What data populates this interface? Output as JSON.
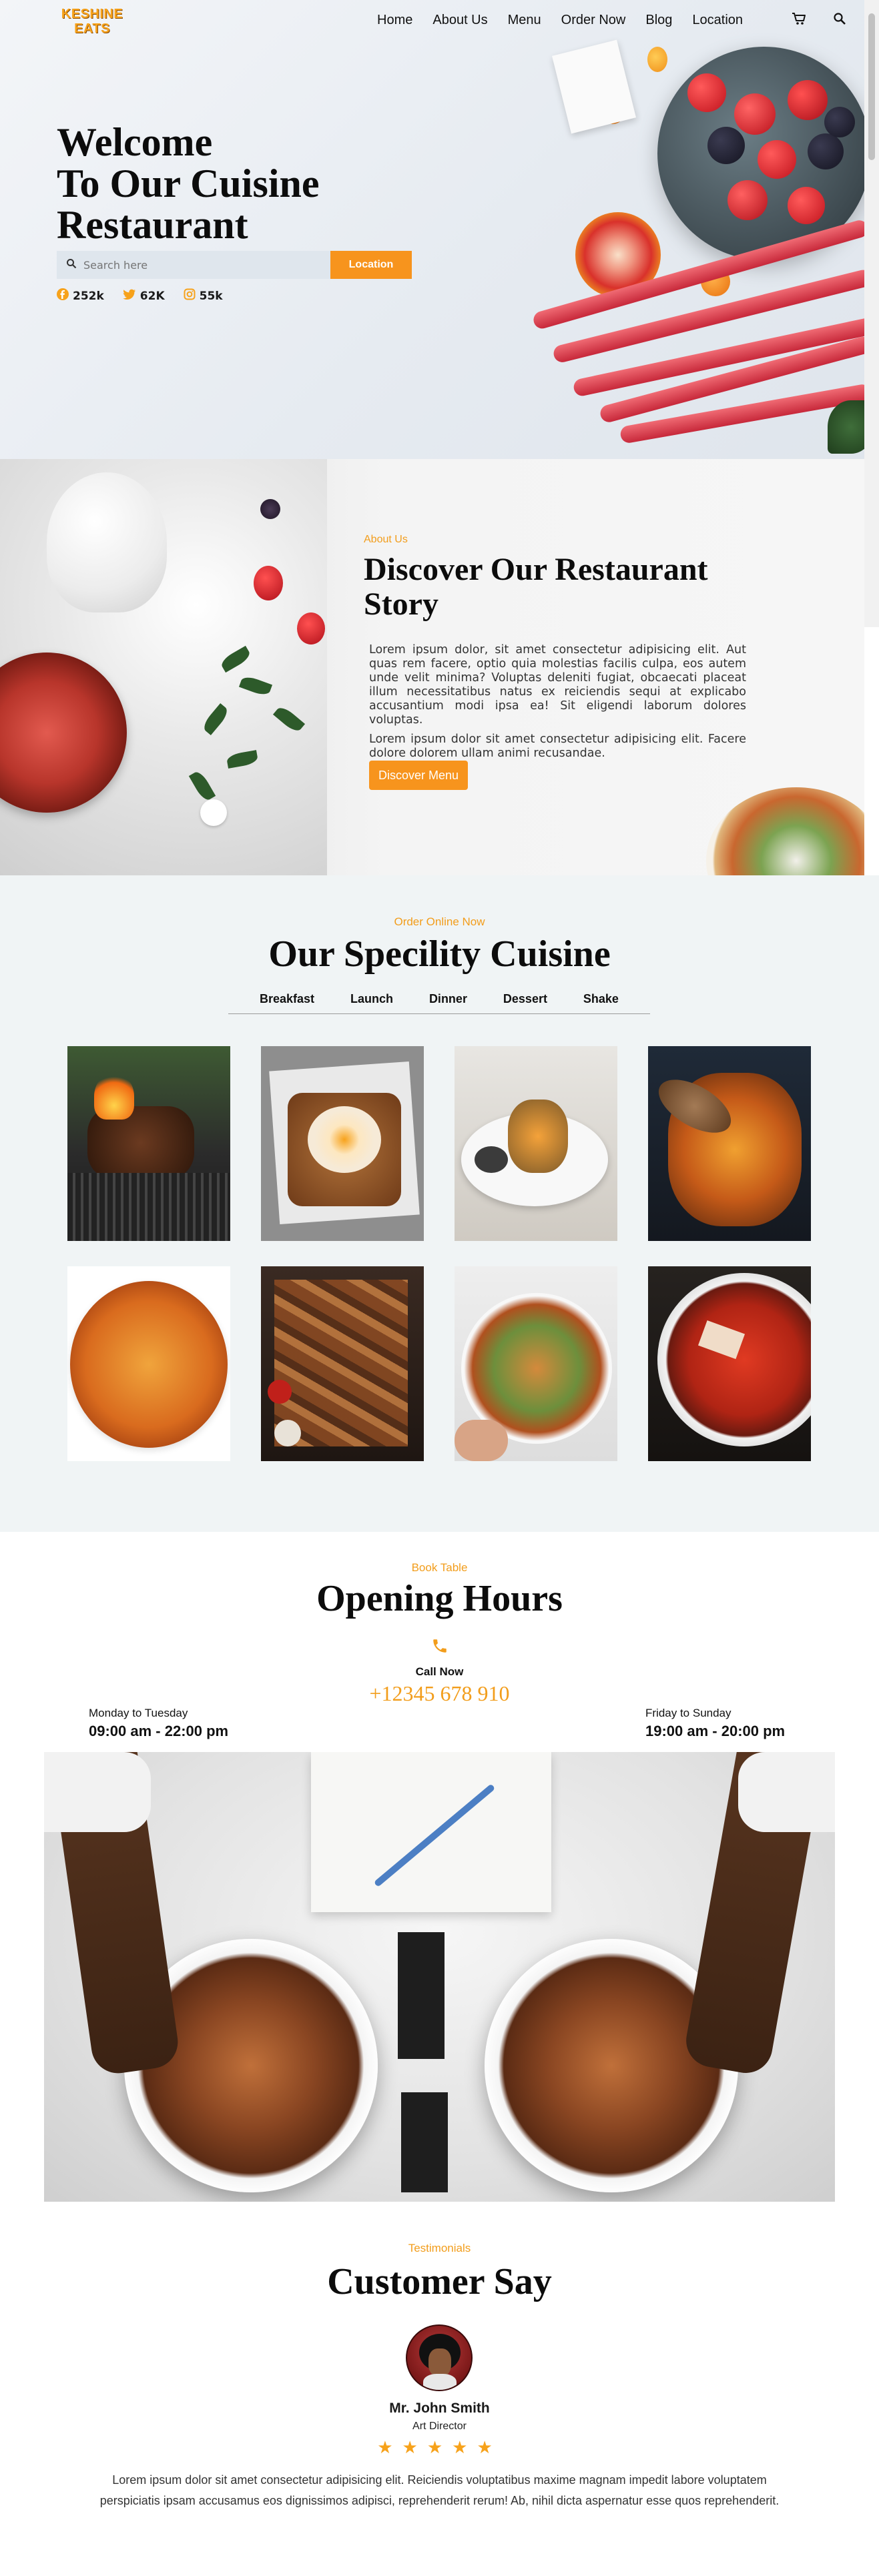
{
  "brand": {
    "logo_line1": "KESHINE",
    "logo_line2": "EATS"
  },
  "nav": {
    "links": [
      "Home",
      "About Us",
      "Menu",
      "Order Now",
      "Blog",
      "Location"
    ],
    "cart_icon": "cart-icon",
    "search_icon": "search-icon"
  },
  "hero": {
    "title_line1": "Welcome",
    "title_line2": "To Our Cuisine",
    "title_line3": "Restaurant",
    "search_placeholder": "Search here",
    "location_button": "Location",
    "socials": [
      {
        "icon": "facebook-icon",
        "count": "252k",
        "color": "#f7a21b"
      },
      {
        "icon": "twitter-icon",
        "count": "62K",
        "color": "#f7a21b"
      },
      {
        "icon": "instagram-icon",
        "count": "55k",
        "color": "#f7a21b"
      }
    ]
  },
  "about": {
    "subtitle": "About Us",
    "title": "Discover Our Restaurant Story",
    "paragraph1": "Lorem ipsum dolor, sit amet consectetur adipisicing elit. Aut quas rem facere, optio quia molestias facilis culpa, eos autem unde velit minima? Voluptas deleniti fugiat, obcaecati placeat illum necessitatibus natus ex reiciendis sequi at explicabo accusantium modi ipsa ea! Sit eligendi laborum dolores voluptas.",
    "paragraph2": "Lorem ipsum dolor sit amet consectetur adipisicing elit. Facere dolore dolorem ullam animi recusandae.",
    "button": "Discover Menu"
  },
  "specialty": {
    "subtitle": "Order Online Now",
    "title": "Our Specility Cuisine",
    "tabs": [
      "Breakfast",
      "Launch",
      "Dinner",
      "Dessert",
      "Shake"
    ]
  },
  "hours": {
    "subtitle": "Book Table",
    "title": "Opening Hours",
    "call_label": "Call Now",
    "phone": "+12345 678 910",
    "weekday_label": "Monday to Tuesday",
    "weekday_hours": "09:00 am - 22:00 pm",
    "weekend_label": "Friday to Sunday",
    "weekend_hours": "19:00 am - 20:00 pm"
  },
  "testimonials": {
    "subtitle": "Testimonials",
    "title": "Customer Say",
    "name": "Mr. John Smith",
    "role": "Art Director",
    "stars": "★★★★★",
    "rating": 5,
    "quote": "Lorem ipsum dolor sit amet consectetur adipisicing elit. Reiciendis voluptatibus maxime magnam impedit labore voluptatem perspiciatis ipsam accusamus eos dignissimos adipisci, reprehenderit rerum! Ab, nihil dicta aspernatur esse quos reprehenderit."
  },
  "colors": {
    "accent": "#f7941d",
    "accent_text": "#f29d1b",
    "section_bg": "#f0f4f5"
  }
}
